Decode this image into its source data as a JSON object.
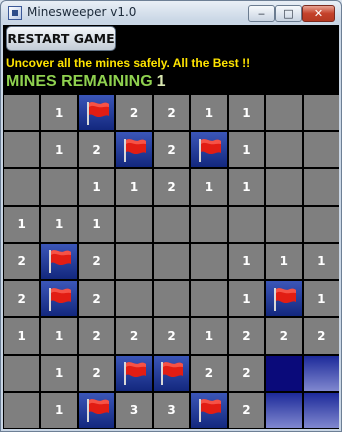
{
  "window": {
    "title": "Minesweeper v1.0",
    "controls": {
      "minimize": "‒",
      "maximize": "□",
      "close": "✕"
    }
  },
  "toolbar": {
    "restart_label": "RESTART GAME"
  },
  "message": "Uncover all the mines safely. All the Best !!",
  "mines": {
    "label": "MINES REMAINING",
    "count": "1"
  },
  "colors": {
    "message": "#ffe400",
    "mines_label": "#8fd14f",
    "revealed_cell": "#7f7f7f",
    "flag_cell": "#1f36a0",
    "hidden_cell": "#5a64c0",
    "background": "#000000"
  },
  "board": {
    "rows": [
      [
        "",
        "1",
        "F",
        "2",
        "2",
        "1",
        "1",
        "",
        ""
      ],
      [
        "",
        "1",
        "2",
        "F",
        "2",
        "F",
        "1",
        "",
        ""
      ],
      [
        "",
        "",
        "1",
        "1",
        "2",
        "1",
        "1",
        "",
        ""
      ],
      [
        "1",
        "1",
        "1",
        "",
        "",
        "",
        "",
        "",
        ""
      ],
      [
        "2",
        "F",
        "2",
        "",
        "",
        "",
        "1",
        "1",
        "1"
      ],
      [
        "2",
        "F",
        "2",
        "",
        "",
        "",
        "1",
        "F",
        "1"
      ],
      [
        "1",
        "1",
        "2",
        "2",
        "2",
        "1",
        "2",
        "2",
        "2"
      ],
      [
        "",
        "1",
        "2",
        "F",
        "F",
        "2",
        "2",
        "S",
        "H"
      ],
      [
        "",
        "1",
        "F",
        "3",
        "3",
        "F",
        "2",
        "H",
        "H"
      ]
    ],
    "legend": {
      "F": "flag",
      "H": "hidden",
      "S": "hidden-selected"
    }
  }
}
